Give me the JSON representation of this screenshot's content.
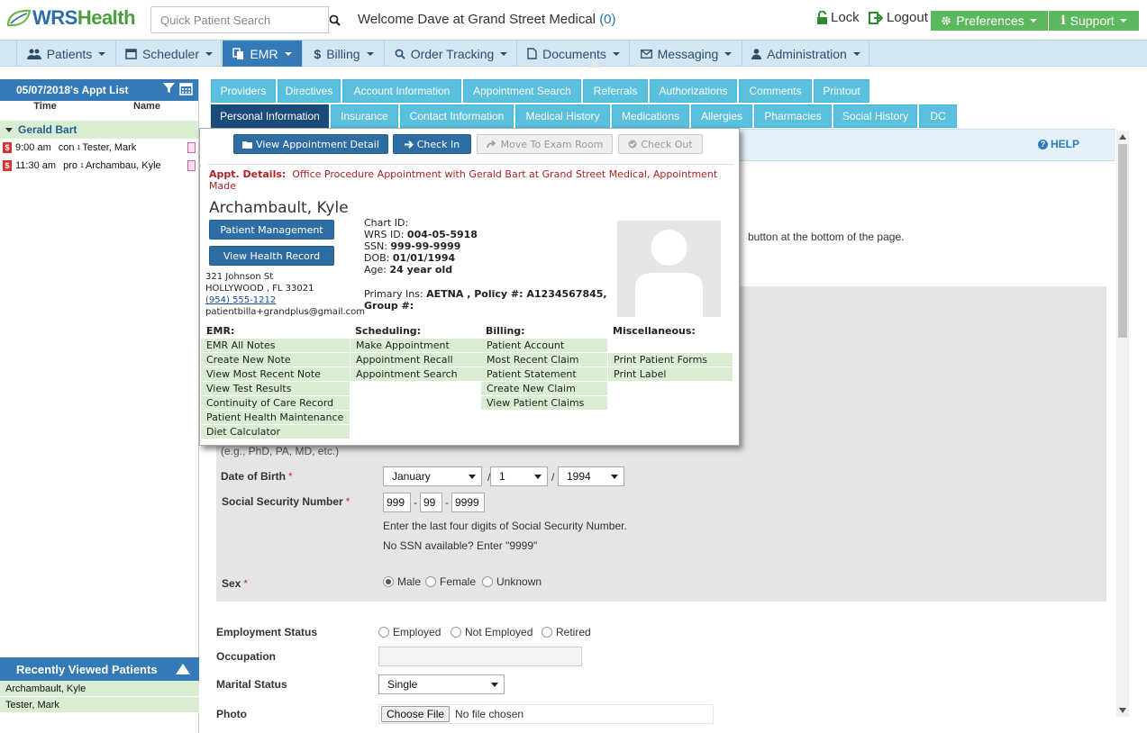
{
  "header": {
    "logo_text_a": "WRS",
    "logo_text_b": "Health",
    "search_placeholder": "Quick Patient Search",
    "welcome": "Welcome Dave at Grand Street Medical",
    "welcome_count": "(0)",
    "lock_label": "Lock",
    "logout_label": "Logout",
    "preferences_label": "Preferences",
    "support_label": "Support"
  },
  "nav": [
    {
      "label": "Patients",
      "icon": "users-icon"
    },
    {
      "label": "Scheduler",
      "icon": "calendar-icon"
    },
    {
      "label": "EMR",
      "icon": "copy-icon",
      "active": true
    },
    {
      "label": "Billing",
      "icon": "dollar-icon"
    },
    {
      "label": "Order Tracking",
      "icon": "search-icon"
    },
    {
      "label": "Documents",
      "icon": "file-icon"
    },
    {
      "label": "Messaging",
      "icon": "envelope-icon"
    },
    {
      "label": "Administration",
      "icon": "user-icon"
    }
  ],
  "sidebar": {
    "appt_title": "05/07/2018's Appt List",
    "col_time": "Time",
    "col_name": "Name",
    "group_name": "Gerald Bart",
    "appts": [
      {
        "time": "9:00 am",
        "type": "con",
        "sup": "1",
        "name": "Tester, Mark"
      },
      {
        "time": "11:30 am",
        "type": "pro",
        "sup": "1",
        "name": "Archambau, Kyle"
      }
    ],
    "recent_title": "Recently Viewed Patients",
    "recent": [
      "Archambault, Kyle",
      "Tester, Mark"
    ]
  },
  "tabs_row1": [
    "Providers",
    "Directives",
    "Account Information",
    "Appointment Search",
    "Referrals",
    "Authorizations",
    "Comments",
    "Printout"
  ],
  "tabs_row2": [
    "Personal Information",
    "Insurance",
    "Contact Information",
    "Medical History",
    "Medications",
    "Allergies",
    "Pharmacies",
    "Social History",
    "DC"
  ],
  "help_label": "HELP",
  "bottom_note": "button at the bottom of the page.",
  "form": {
    "degree_hint": "(e.g., PhD, PA, MD, etc.)",
    "dob_label": "Date of Birth",
    "dob_month": "January",
    "dob_day": "1",
    "dob_year": "1994",
    "ssn_label": "Social Security Number",
    "ssn_1": "999",
    "ssn_2": "99",
    "ssn_3": "9999",
    "ssn_hint1": "Enter the last four digits of Social Security Number.",
    "ssn_hint2": "No SSN available? Enter \"9999\"",
    "sex_label": "Sex",
    "sex_options": [
      "Male",
      "Female",
      "Unknown"
    ],
    "employment_label": "Employment Status",
    "employment_options": [
      "Employed",
      "Not Employed",
      "Retired"
    ],
    "occupation_label": "Occupation",
    "marital_label": "Marital Status",
    "marital_value": "Single",
    "photo_label": "Photo",
    "choose_file": "Choose File",
    "no_file": "No file chosen"
  },
  "popup": {
    "btn_view_detail": "View Appointment Detail",
    "btn_check_in": "Check In",
    "btn_move_exam": "Move To Exam Room",
    "btn_check_out": "Check Out",
    "appt_label": "Appt. Details:",
    "appt_text": "Office Procedure Appointment with Gerald Bart at Grand Street Medical, Appointment Made",
    "patient_name": "Archambault, Kyle",
    "btn_patient_mgmt": "Patient Management",
    "btn_health_record": "View Health Record",
    "address1": "321 Johnson St",
    "address2": "HOLLYWOOD , FL 33021",
    "phone": "(954) 555-1212",
    "email": "patientbilla+grandplus@gmail.com",
    "chart_id_label": "Chart ID:",
    "wrs_id_label": "WRS ID:",
    "wrs_id": "004-05-5918",
    "ssn_label": "SSN:",
    "ssn": "999-99-9999",
    "dob_label": "DOB:",
    "dob": "01/01/1994",
    "age_label": "Age:",
    "age": "24 year old",
    "primary_ins_label": "Primary Ins:",
    "primary_ins": "AETNA , Policy #: A1234567845,",
    "group_label": "Group #:",
    "emr_title": "EMR:",
    "emr_items": [
      "EMR All Notes",
      "Create New Note",
      "View Most Recent Note",
      "View Test Results",
      "Continuity of Care Record",
      "Patient Health Maintenance",
      "Diet Calculator"
    ],
    "sched_title": "Scheduling:",
    "sched_items": [
      "Make Appointment",
      "Appointment Recall",
      "Appointment Search"
    ],
    "billing_title": "Billing:",
    "billing_items": [
      "Patient Account",
      "Most Recent Claim",
      "Patient Statement",
      "Create New Claim",
      "View Patient Claims"
    ],
    "misc_title": "Miscellaneous:",
    "misc_items": [
      "",
      "Print Patient Forms",
      "Print Label"
    ]
  }
}
